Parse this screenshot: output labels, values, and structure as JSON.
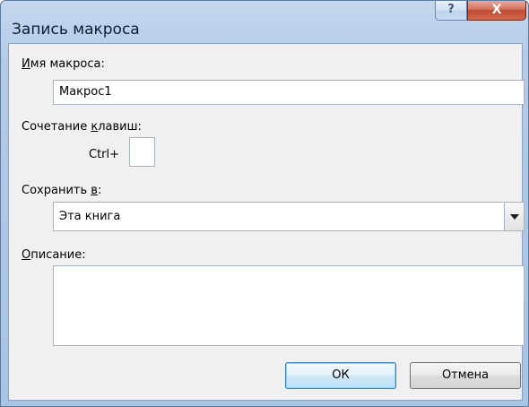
{
  "window": {
    "title": "Запись макроса",
    "help_glyph": "?",
    "close_glyph": "X"
  },
  "macro_name": {
    "label_accel": "И",
    "label_rest": "мя макроса:",
    "value": "Макрос1"
  },
  "shortcut": {
    "label_before": "Сочетание ",
    "label_accel": "к",
    "label_after": "лавиш:",
    "prefix": "Ctrl+",
    "value": ""
  },
  "store_in": {
    "label_before": "Сохранить ",
    "label_accel": "в",
    "label_after": ":",
    "selected": "Эта книга"
  },
  "description": {
    "label_accel": "О",
    "label_rest": "писание:",
    "value": ""
  },
  "buttons": {
    "ok": "ОК",
    "cancel": "Отмена"
  },
  "colors": {
    "frame": "#a9c3e4",
    "close": "#c24a2f",
    "default_button_border": "#3c7fb1",
    "body": "#f0f0f0"
  }
}
